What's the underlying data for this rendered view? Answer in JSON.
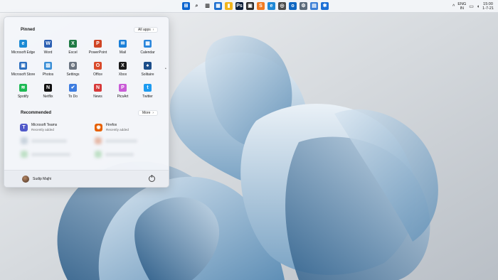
{
  "taskbar": {
    "icons": [
      {
        "name": "windows-start-icon",
        "glyph": "⊞",
        "color": "#0a64d0"
      },
      {
        "name": "search-icon",
        "glyph": "⌕",
        "color": "#333333"
      },
      {
        "name": "task-view-icon",
        "glyph": "▥",
        "color": "#333333"
      },
      {
        "name": "widgets-icon",
        "glyph": "▦",
        "color": "#1e6fd0"
      },
      {
        "name": "file-explorer-icon",
        "glyph": "▮",
        "color": "#f2b51c"
      },
      {
        "name": "photoshop-icon",
        "glyph": "Ps",
        "color": "#0d1f3a"
      },
      {
        "name": "app-icon-dark",
        "glyph": "▣",
        "color": "#2c2c2c"
      },
      {
        "name": "sublime-text-icon",
        "glyph": "S",
        "color": "#f07a21"
      },
      {
        "name": "edge-icon",
        "glyph": "e",
        "color": "#1e88d6"
      },
      {
        "name": "dev-tool-icon",
        "glyph": "◎",
        "color": "#4b4b4b"
      },
      {
        "name": "outlook-icon",
        "glyph": "o",
        "color": "#0f67c2"
      },
      {
        "name": "settings-icon",
        "glyph": "⚙",
        "color": "#5c6b7a"
      },
      {
        "name": "network-monitor-icon",
        "glyph": "▤",
        "color": "#3d7fd6"
      },
      {
        "name": "vpn-icon",
        "glyph": "✱",
        "color": "#1c6fd6"
      }
    ],
    "tray": {
      "chevron": "^",
      "lang_top": "ENG",
      "lang_bottom": "IN",
      "display_glyph": "▭",
      "volume_glyph": "◖",
      "time": "15:00",
      "date": "1-7-21"
    }
  },
  "start_menu": {
    "pinned_title": "Pinned",
    "all_apps_label": "All apps",
    "pinned": [
      {
        "label": "Microsoft Edge",
        "icon": "edge-icon",
        "glyph": "e",
        "color": "#1b8ad4"
      },
      {
        "label": "Word",
        "icon": "word-icon",
        "glyph": "W",
        "color": "#2b5fb3"
      },
      {
        "label": "Excel",
        "icon": "excel-icon",
        "glyph": "X",
        "color": "#1f7a44"
      },
      {
        "label": "PowerPoint",
        "icon": "powerpoint-icon",
        "glyph": "P",
        "color": "#d04424"
      },
      {
        "label": "Mail",
        "icon": "mail-icon",
        "glyph": "✉",
        "color": "#1a7fd8"
      },
      {
        "label": "Calendar",
        "icon": "calendar-icon",
        "glyph": "▦",
        "color": "#2a86dc"
      },
      {
        "label": "Microsoft Store",
        "icon": "store-icon",
        "glyph": "▣",
        "color": "#2d6fbf"
      },
      {
        "label": "Photos",
        "icon": "photos-icon",
        "glyph": "▨",
        "color": "#3b8fd6"
      },
      {
        "label": "Settings",
        "icon": "settings-icon",
        "glyph": "⚙",
        "color": "#6b7480"
      },
      {
        "label": "Office",
        "icon": "office-icon",
        "glyph": "O",
        "color": "#d94a2b"
      },
      {
        "label": "Xbox",
        "icon": "xbox-icon",
        "glyph": "X",
        "color": "#1a1a1a"
      },
      {
        "label": "Solitaire",
        "icon": "solitaire-icon",
        "glyph": "♠",
        "color": "#1c4e8a"
      },
      {
        "label": "Spotify",
        "icon": "spotify-icon",
        "glyph": "≋",
        "color": "#1db954"
      },
      {
        "label": "Netflix",
        "icon": "netflix-icon",
        "glyph": "N",
        "color": "#101010"
      },
      {
        "label": "To Do",
        "icon": "todo-icon",
        "glyph": "✔",
        "color": "#3e7de0"
      },
      {
        "label": "News",
        "icon": "news-icon",
        "glyph": "N",
        "color": "#d73a3a"
      },
      {
        "label": "PicsArt",
        "icon": "picsart-icon",
        "glyph": "P",
        "color": "#c95bd6"
      },
      {
        "label": "Twitter",
        "icon": "twitter-icon",
        "glyph": "t",
        "color": "#1d9bf0"
      }
    ],
    "recommended_title": "Recommended",
    "more_label": "More",
    "recommended": [
      {
        "name": "Microsoft Teams",
        "sub": "Recently added",
        "icon": "teams-icon",
        "glyph": "T",
        "color": "#5059c9"
      },
      {
        "name": "Firefox",
        "sub": "Recently added",
        "icon": "firefox-icon",
        "glyph": "◉",
        "color": "#e66000"
      }
    ],
    "user_name": "Sudip Majhi"
  }
}
